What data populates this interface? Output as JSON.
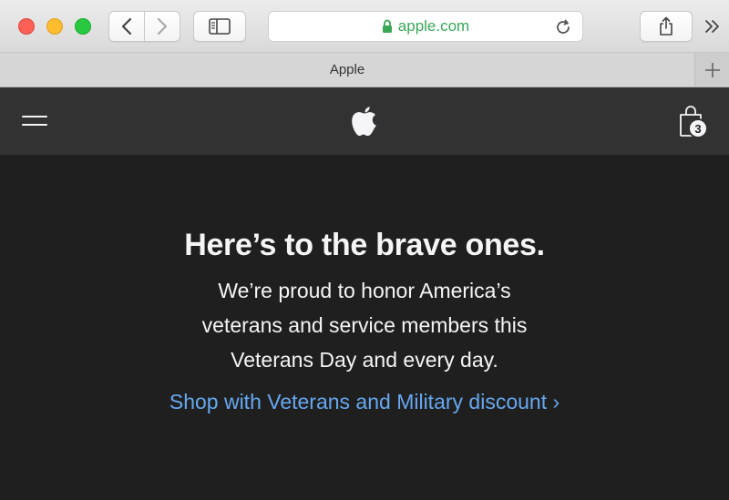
{
  "browser": {
    "address_url": "apple.com",
    "tab_title": "Apple",
    "colors": {
      "url_text": "#3aa757",
      "toolbar": "#e3e3e3"
    },
    "icons": {
      "back": "chevron-left-icon",
      "forward": "chevron-right-icon",
      "sidebar": "sidebar-icon",
      "lock": "lock-icon",
      "reload": "reload-icon",
      "share": "share-icon",
      "more": "double-chevron-icon",
      "new_tab": "plus-icon"
    }
  },
  "nav": {
    "menu_icon": "hamburger-icon",
    "logo": "apple-logo",
    "bag_icon": "bag-icon",
    "bag_count": "3",
    "background": "#323232"
  },
  "hero": {
    "headline": "Here’s to the brave ones.",
    "subcopy_lines": [
      "We’re proud to honor America’s",
      "veterans and service members this",
      "Veterans Day and every day."
    ],
    "cta": "Shop with Veterans and Military discount ›",
    "colors": {
      "background": "#1f1f1f",
      "text": "#f5f5f7",
      "link": "#66a8f0"
    }
  }
}
